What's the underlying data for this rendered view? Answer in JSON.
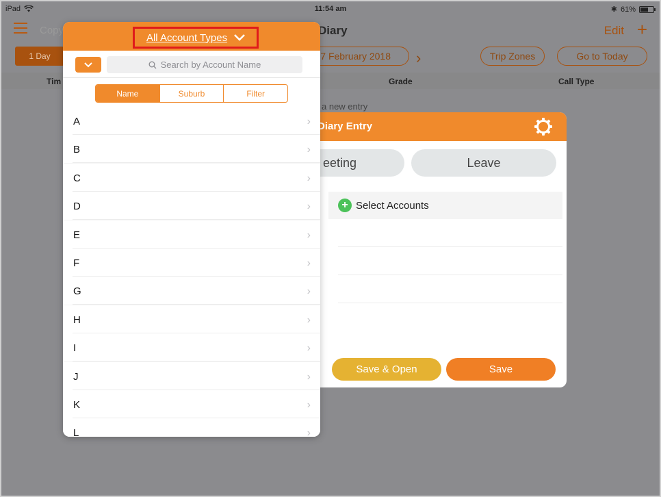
{
  "status_bar": {
    "device": "iPad",
    "time": "11:54 am",
    "battery": "61%",
    "battery_level": 0.61
  },
  "nav": {
    "copy_text": "Copy",
    "title": "Diary",
    "edit_label": "Edit",
    "add_label": "+"
  },
  "toolbar": {
    "day_label": "1 Day",
    "date_label": "7 February 2018",
    "trip_zones_label": "Trip Zones",
    "go_today_label": "Go to Today"
  },
  "table_headers": {
    "time": "Tim",
    "grade": "Grade",
    "call_type": "Call Type"
  },
  "hint_text": "a new entry",
  "diary_entry": {
    "title": "Diary Entry",
    "meeting_label": "eeting",
    "leave_label": "Leave",
    "select_accounts_label": "Select Accounts",
    "save_open_label": "Save & Open",
    "save_label": "Save"
  },
  "popover": {
    "account_types_label": "All Account Types",
    "search_placeholder": "Search by Account Name",
    "segments": [
      {
        "label": "Name",
        "active": true
      },
      {
        "label": "Suburb",
        "active": false
      },
      {
        "label": "Filter",
        "active": false
      }
    ],
    "letters": [
      "A",
      "B",
      "C",
      "D",
      "E",
      "F",
      "G",
      "H",
      "I",
      "J",
      "K",
      "L"
    ]
  },
  "colors": {
    "accent": "#f08a2c",
    "highlight_box": "#e01b1b",
    "save_open": "#e5b232",
    "save": "#f07f25",
    "add_green": "#4cc25a"
  }
}
